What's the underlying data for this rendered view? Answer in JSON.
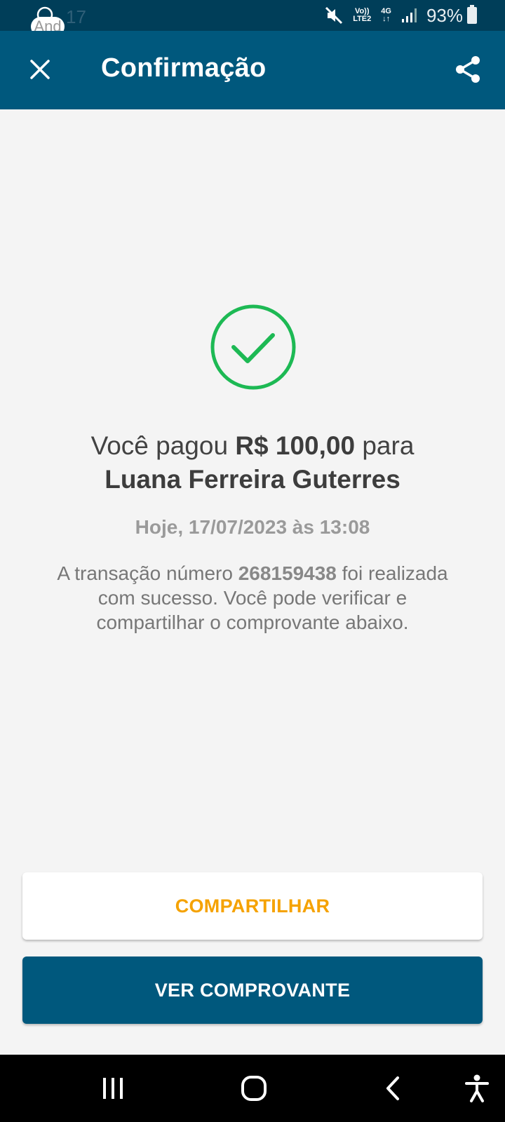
{
  "status_bar": {
    "time": "17",
    "notification_pill": "And",
    "signal_label_top": "Vo))",
    "signal_label_bottom": "LTE2",
    "network": "4G",
    "battery": "93%"
  },
  "app_bar": {
    "title": "Confirmação"
  },
  "confirmation": {
    "prefix": "Você pagou ",
    "amount": "R$ 100,00",
    "suffix": " para",
    "recipient": "Luana Ferreira Guterres",
    "datetime": "Hoje, 17/07/2023 às 13:08",
    "desc_before": "A transação número ",
    "transaction_number": "268159438",
    "desc_after": " foi realizada com sucesso. Você pode verificar e compartilhar o comprovante abaixo."
  },
  "buttons": {
    "share_label": "COMPARTILHAR",
    "receipt_label": "VER COMPROVANTE"
  },
  "colors": {
    "status_bar": "#003e59",
    "app_bar": "#00587d",
    "success_green": "#1db954",
    "share_text": "#f5a200",
    "primary_button": "#00587d"
  },
  "icons": {
    "close": "close-icon",
    "share": "share-icon",
    "success": "check-circle-icon",
    "nav_recents": "recents-icon",
    "nav_home": "home-icon",
    "nav_back": "back-icon",
    "nav_accessibility": "accessibility-icon"
  }
}
